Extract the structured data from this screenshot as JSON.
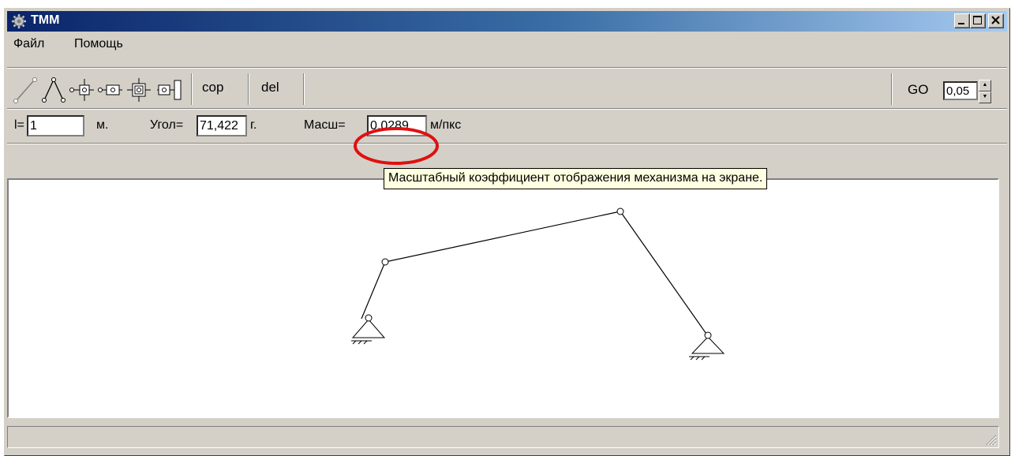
{
  "window": {
    "title": "TMM"
  },
  "menu": {
    "items": [
      "Файл",
      "Помощь"
    ]
  },
  "toolbar": {
    "tools": [
      "link-tool",
      "dyad-tool",
      "slider-tool",
      "slider-joint-tool",
      "guide-slider-tool",
      "slider-end-tool"
    ],
    "cop_label": "cop",
    "del_label": "del",
    "go_label": "GO",
    "go_value": "0,05"
  },
  "params": {
    "l_label": "l=",
    "l_value": "1",
    "l_unit": "м.",
    "angle_label": "Угол=",
    "angle_value": "71,422",
    "angle_unit": "г.",
    "scale_label": "Масш=",
    "scale_value": "0,0289",
    "scale_unit": "м/пкс"
  },
  "tooltip": {
    "text": "Масштабный коэффициент отображения механизма на экране."
  },
  "colors": {
    "title_gradient_start": "#0a246a",
    "title_gradient_end": "#a6caf0",
    "highlight": "#e01010",
    "tooltip_bg": "#ffffe1"
  },
  "mechanism": {
    "type": "four-bar linkage",
    "joints": [
      "fixed-support-left",
      "joint-b",
      "joint-c",
      "fixed-support-right"
    ]
  }
}
